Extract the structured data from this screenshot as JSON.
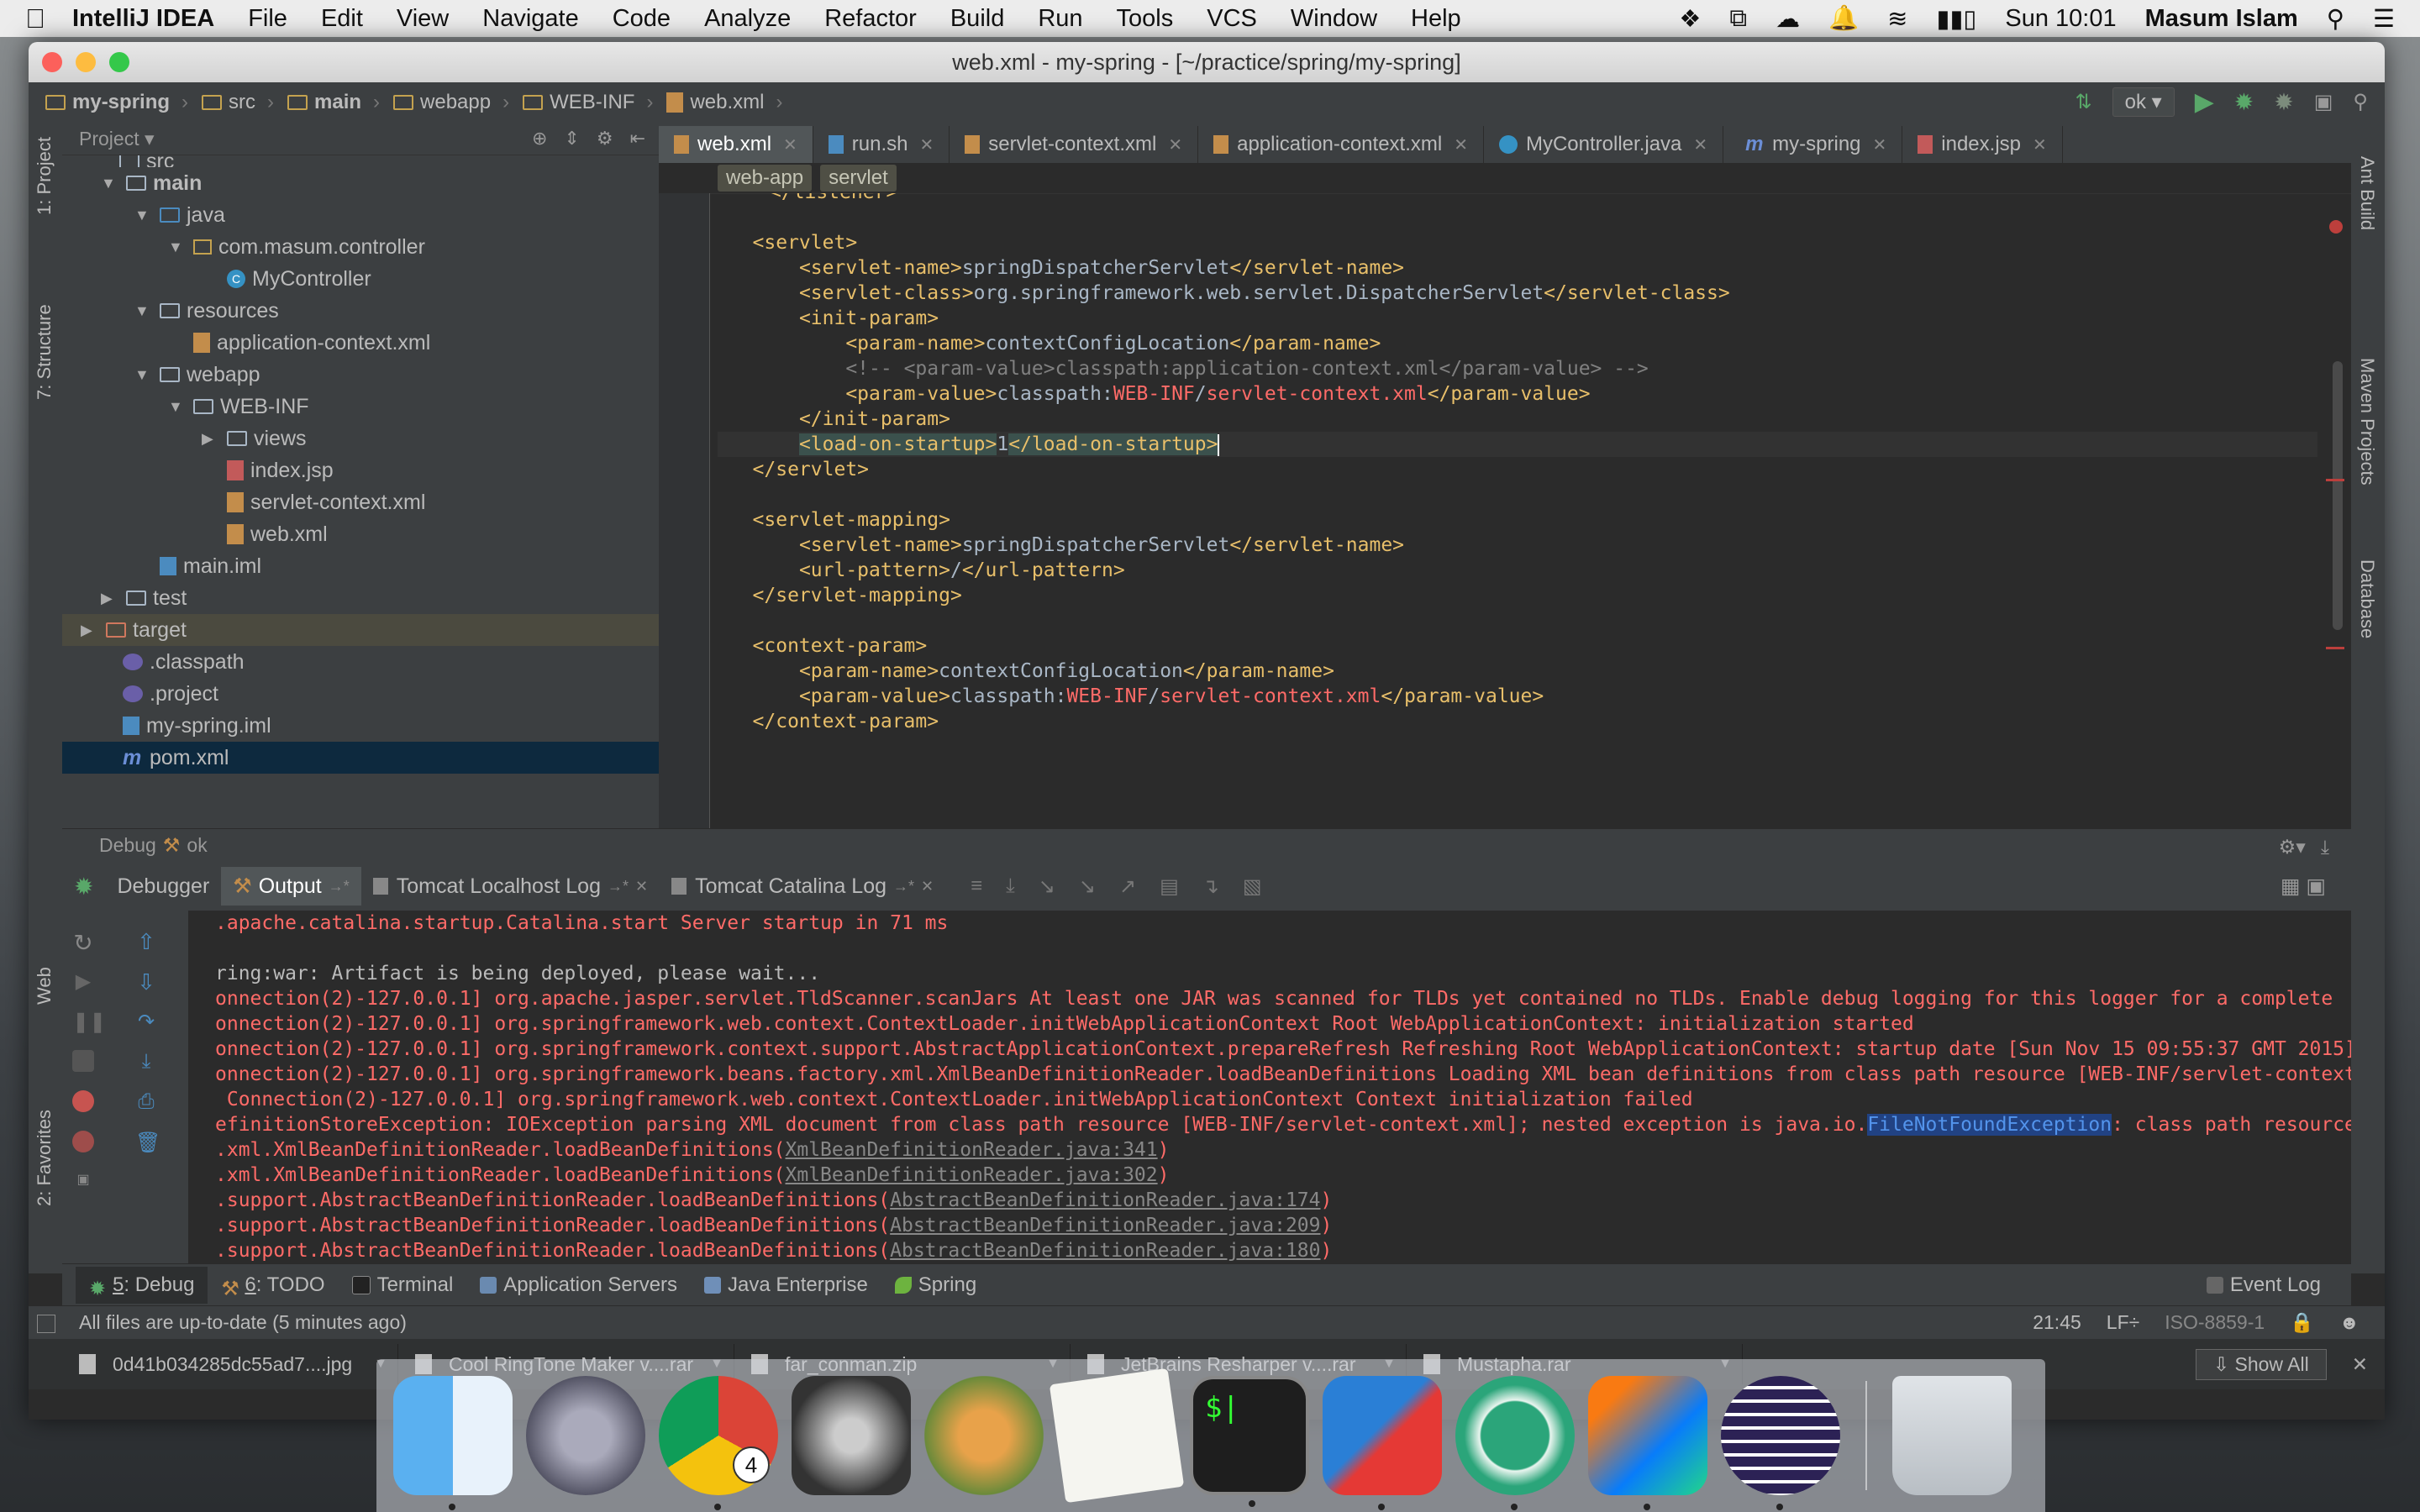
{
  "menubar": {
    "app": "IntelliJ IDEA",
    "menus": [
      "File",
      "Edit",
      "View",
      "Navigate",
      "Code",
      "Analyze",
      "Refactor",
      "Build",
      "Run",
      "Tools",
      "VCS",
      "Window",
      "Help"
    ],
    "clock": "Sun 10:01",
    "user": "Masum Islam"
  },
  "window": {
    "title": "web.xml - my-spring - [~/practice/spring/my-spring]"
  },
  "navbar": {
    "crumbs": [
      "my-spring",
      "src",
      "main",
      "webapp",
      "WEB-INF",
      "web.xml"
    ],
    "run_config": "ok"
  },
  "side_tabs": {
    "project": "1: Project",
    "structure": "7: Structure",
    "web": "Web",
    "favorites": "2: Favorites",
    "ant": "Ant Build",
    "maven": "Maven Projects",
    "database": "Database"
  },
  "project": {
    "header": "Project",
    "tree": [
      {
        "label": "src",
        "type": "dir"
      },
      {
        "label": "main",
        "type": "dir"
      },
      {
        "label": "java",
        "type": "dir"
      },
      {
        "label": "com.masum.controller",
        "type": "pkg"
      },
      {
        "label": "MyController",
        "type": "class"
      },
      {
        "label": "resources",
        "type": "dir"
      },
      {
        "label": "application-context.xml",
        "type": "xml"
      },
      {
        "label": "webapp",
        "type": "dir"
      },
      {
        "label": "WEB-INF",
        "type": "dir"
      },
      {
        "label": "views",
        "type": "dir"
      },
      {
        "label": "index.jsp",
        "type": "jsp"
      },
      {
        "label": "servlet-context.xml",
        "type": "xml"
      },
      {
        "label": "web.xml",
        "type": "xml"
      },
      {
        "label": "main.iml",
        "type": "iml"
      },
      {
        "label": "test",
        "type": "dir"
      },
      {
        "label": "target",
        "type": "target"
      },
      {
        "label": ".classpath",
        "type": "cp"
      },
      {
        "label": ".project",
        "type": "cp"
      },
      {
        "label": "my-spring.iml",
        "type": "iml"
      },
      {
        "label": "pom.xml",
        "type": "m"
      }
    ]
  },
  "editor": {
    "tabs": [
      "web.xml",
      "run.sh",
      "servlet-context.xml",
      "application-context.xml",
      "MyController.java",
      "my-spring",
      "index.jsp"
    ],
    "xml_crumbs": [
      "web-app",
      "servlet"
    ],
    "lines": {
      "l0": "</listener>",
      "l1": "",
      "l2": "<servlet>",
      "l3a": "<servlet-name>",
      "l3b": "springDispatcherServlet",
      "l3c": "</servlet-name>",
      "l4a": "<servlet-class>",
      "l4b": "org.springframework.web.servlet.DispatcherServlet",
      "l4c": "</servlet-class>",
      "l5": "<init-param>",
      "l6a": "<param-name>",
      "l6b": "contextConfigLocation",
      "l6c": "</param-name>",
      "l7": "<!-- <param-value>classpath:application-context.xml</param-value> -->",
      "l8a": "<param-value>",
      "l8b": "classpath:",
      "l8c": "WEB-INF",
      "l8d": "/",
      "l8e": "servlet-context.xml",
      "l8f": "</param-value>",
      "l9": "</init-param>",
      "l10a": "<load-on-startup>",
      "l10b": "1",
      "l10c": "</load-on-startup>",
      "l11": "</servlet>",
      "l12": "",
      "l13": "<servlet-mapping>",
      "l14a": "<servlet-name>",
      "l14b": "springDispatcherServlet",
      "l14c": "</servlet-name>",
      "l15a": "<url-pattern>",
      "l15b": "/",
      "l15c": "</url-pattern>",
      "l16": "</servlet-mapping>",
      "l17": "",
      "l18": "<context-param>",
      "l19a": "<param-name>",
      "l19b": "contextConfigLocation",
      "l19c": "</param-name>",
      "l20a": "<param-value>",
      "l20b": "classpath:",
      "l20c": "WEB-INF",
      "l20d": "/",
      "l20e": "servlet-context.xml",
      "l20f": "</param-value>",
      "l21": "</context-param>"
    }
  },
  "debug": {
    "header_label": "Debug",
    "config": "ok",
    "tabs": [
      "Debugger",
      "Output",
      "Tomcat Localhost Log",
      "Tomcat Catalina Log"
    ],
    "console": {
      "c0": ".apache.catalina.startup.Catalina.start Server startup in 71 ms",
      "c1": "",
      "c2": "ring:war: Artifact is being deployed, please wait...",
      "c3": "onnection(2)-127.0.0.1] org.apache.jasper.servlet.TldScanner.scanJars At least one JAR was scanned for TLDs yet contained no TLDs. Enable debug logging for this logger for a complete",
      "c4": "onnection(2)-127.0.0.1] org.springframework.web.context.ContextLoader.initWebApplicationContext Root WebApplicationContext: initialization started",
      "c5": "onnection(2)-127.0.0.1] org.springframework.context.support.AbstractApplicationContext.prepareRefresh Refreshing Root WebApplicationContext: startup date [Sun Nov 15 09:55:37 GMT 2015]",
      "c6": "onnection(2)-127.0.0.1] org.springframework.beans.factory.xml.XmlBeanDefinitionReader.loadBeanDefinitions Loading XML bean definitions from class path resource [WEB-INF/servlet-context",
      "c7": " Connection(2)-127.0.0.1] org.springframework.web.context.ContextLoader.initWebApplicationContext Context initialization failed",
      "c8a": "efinitionStoreException: IOException parsing XML document from class path resource [WEB-INF/servlet-context.xml]; nested exception is java.io.",
      "c8b": "FileNotFoundException",
      "c8c": ": class path resource",
      "c9a": ".xml.XmlBeanDefinitionReader.loadBeanDefinitions(",
      "c9b": "XmlBeanDefinitionReader.java:341",
      "c9c": ")",
      "c10a": ".xml.XmlBeanDefinitionReader.loadBeanDefinitions(",
      "c10b": "XmlBeanDefinitionReader.java:302",
      "c10c": ")",
      "c11a": ".support.AbstractBeanDefinitionReader.loadBeanDefinitions(",
      "c11b": "AbstractBeanDefinitionReader.java:174",
      "c11c": ")",
      "c12a": ".support.AbstractBeanDefinitionReader.loadBeanDefinitions(",
      "c12b": "AbstractBeanDefinitionReader.java:209",
      "c12c": ")",
      "c13a": ".support.AbstractBeanDefinitionReader.loadBeanDefinitions(",
      "c13b": "AbstractBeanDefinitionReader.java:180",
      "c13c": ")"
    }
  },
  "toolwindows": {
    "debug_num": "5",
    "debug": ": Debug",
    "todo_num": "6",
    "todo": ": TODO",
    "terminal": "Terminal",
    "app_servers": "Application Servers",
    "java_ee": "Java Enterprise",
    "spring": "Spring",
    "event_log": "Event Log"
  },
  "status": {
    "message": "All files are up-to-date (5 minutes ago)",
    "position": "21:45",
    "line_sep": "LF÷",
    "encoding": "ISO-8859-1"
  },
  "downloads": {
    "items": [
      "0d41b034285dc55ad7....jpg",
      "Cool RingTone Maker v....rar",
      "far_conman.zip",
      "JetBrains Resharper v....rar",
      "Mustapha.rar"
    ],
    "show_all": "Show All"
  },
  "dock": {
    "chrome_badge": "4"
  },
  "colors": {
    "editor_bg": "#2b2b2b",
    "panel_bg": "#3c3f41",
    "xml_tag": "#e8bf6a",
    "error_red": "#ff6b68",
    "selection": "#0d293e"
  }
}
